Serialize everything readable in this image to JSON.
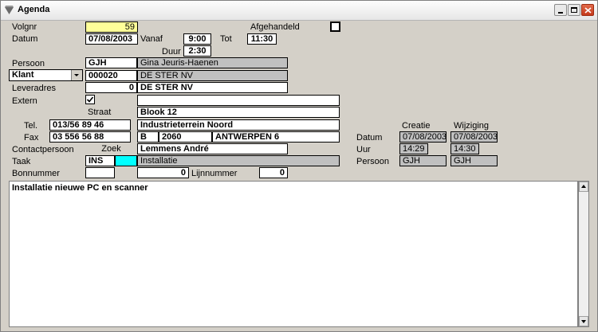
{
  "window": {
    "title": "Agenda"
  },
  "labels": {
    "volgnr": "Volgnr",
    "afgehandeld": "Afgehandeld",
    "datum": "Datum",
    "vanaf": "Vanaf",
    "tot": "Tot",
    "duur": "Duur",
    "persoon": "Persoon",
    "leveradres": "Leveradres",
    "extern": "Extern",
    "straat": "Straat",
    "tel": "Tel.",
    "fax": "Fax",
    "contactpersoon": "Contactpersoon",
    "zoek": "Zoek",
    "taak": "Taak",
    "bonnummer": "Bonnummer",
    "lijnnummer": "Lijnnummer",
    "creatie": "Creatie",
    "wijziging": "Wijziging",
    "audit_datum": "Datum",
    "uur": "Uur",
    "audit_persoon": "Persoon"
  },
  "fields": {
    "volgnr": "59",
    "datum": "07/08/2003",
    "vanaf": "9:00",
    "tot": "11:30",
    "duur": "2:30",
    "persoon_code": "GJH",
    "persoon_name": "Gina Jeuris-Haenen",
    "klant_type": "Klant",
    "klant_code": "000020",
    "klant_name": "DE STER NV",
    "leveradres_code": "0",
    "leveradres_name": "DE STER NV",
    "extern_extra": "",
    "straat_1": "Blook 12",
    "straat_2": "Industrieterrein Noord",
    "tel": "013/56 89 46",
    "fax": "03 556 56 88",
    "country": "B",
    "postcode": "2060",
    "city": "ANTWERPEN 6",
    "contact": "Lemmens André",
    "taak_code": "INS",
    "taak_name": "Installatie",
    "bonnummer": "",
    "bon_value": "0",
    "lijnnummer": "0",
    "creatie_datum": "07/08/2003",
    "wijziging_datum": "07/08/2003",
    "creatie_uur": "14:29",
    "wijziging_uur": "14:30",
    "creatie_persoon": "GJH",
    "wijziging_persoon": "GJH",
    "memo": "Installatie nieuwe PC en scanner"
  },
  "state": {
    "afgehandeld": false,
    "extern": true
  }
}
